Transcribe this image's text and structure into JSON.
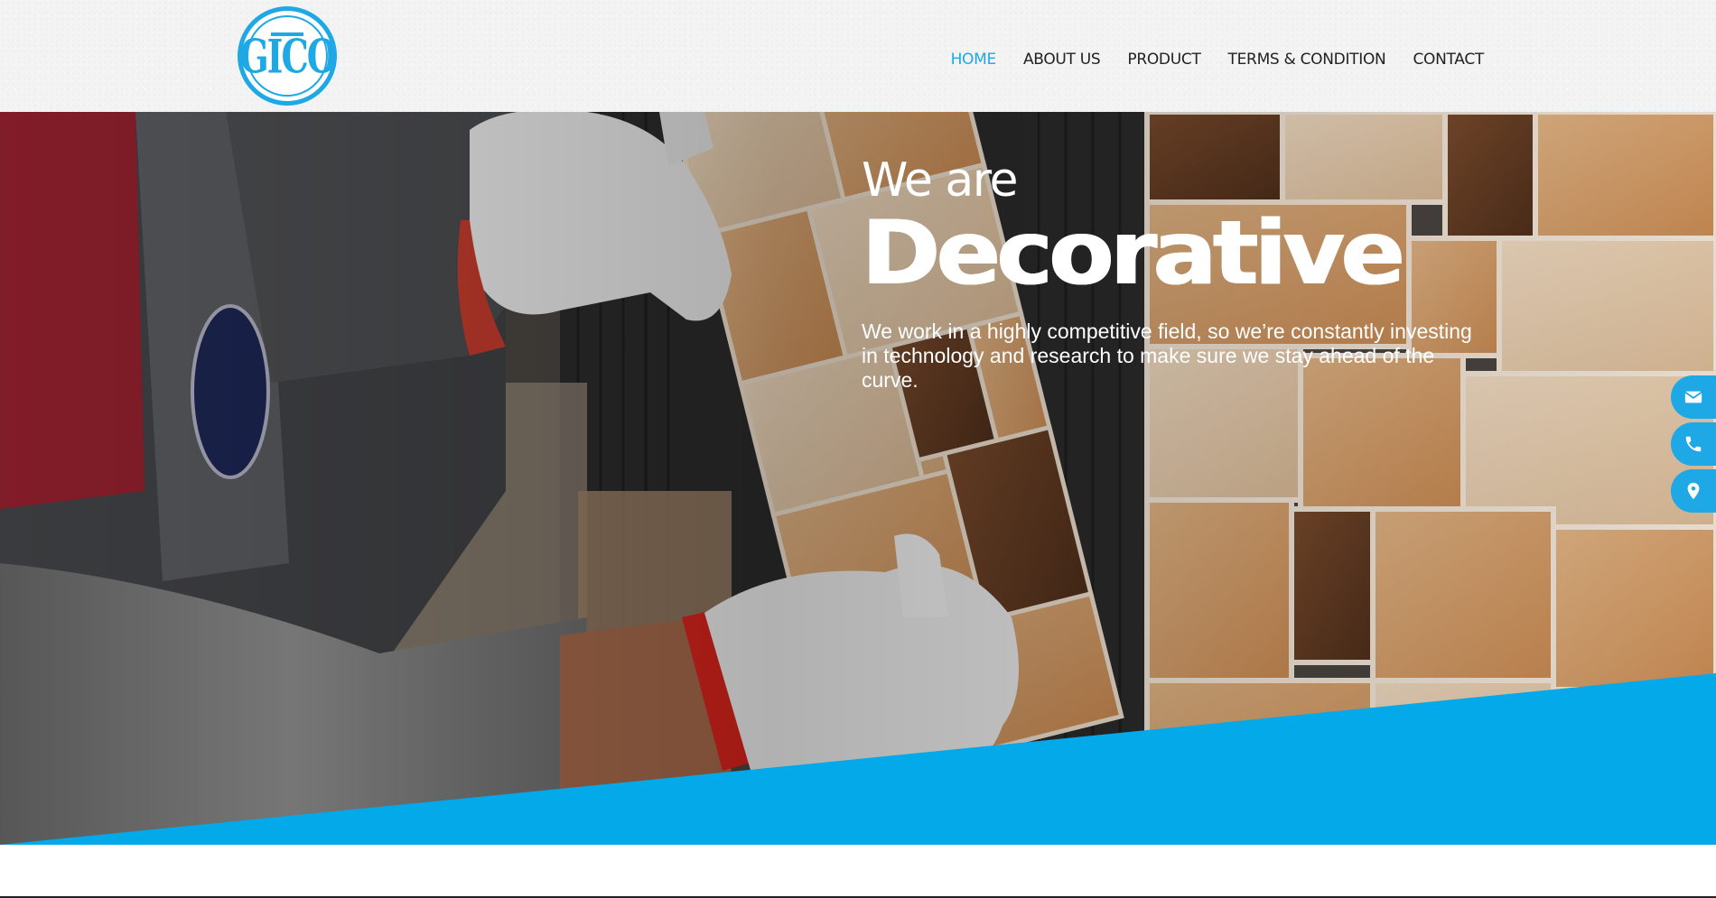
{
  "logo": {
    "text": "GICO",
    "color": "#1ea8e6"
  },
  "nav": {
    "items": [
      {
        "label": "HOME",
        "active": true
      },
      {
        "label": "ABOUT US",
        "active": false
      },
      {
        "label": "PRODUCT",
        "active": false
      },
      {
        "label": "TERMS & CONDITION",
        "active": false
      },
      {
        "label": "CONTACT",
        "active": false
      }
    ]
  },
  "hero": {
    "line1": "We are",
    "line2": "Decorative",
    "description": "We work in a highly competitive field, so we’re constantly investing in technology and research to make sure we stay ahead of the curve."
  },
  "floating_icons": [
    {
      "icon": "envelope-icon"
    },
    {
      "icon": "phone-icon"
    },
    {
      "icon": "map-marker-icon"
    }
  ],
  "colors": {
    "accent": "#1ea8e6",
    "band": "#03a9e8",
    "nav_text": "#222222"
  }
}
